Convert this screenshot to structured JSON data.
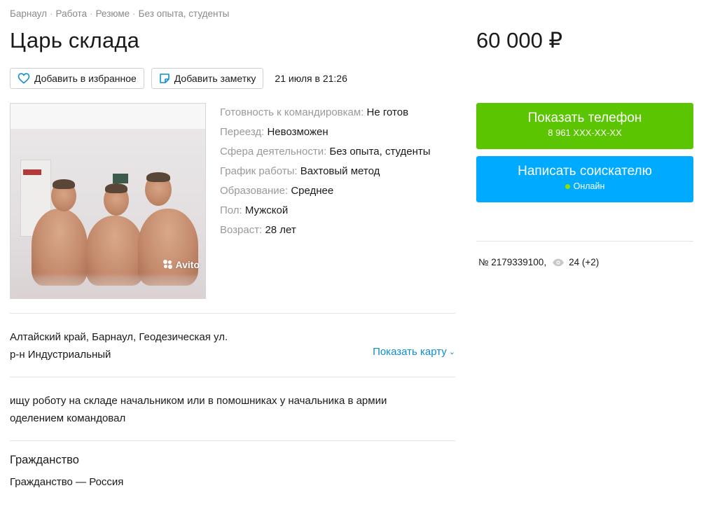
{
  "breadcrumb": {
    "items": [
      "Барнаул",
      "Работа",
      "Резюме",
      "Без опыта, студенты"
    ],
    "separator": "·"
  },
  "title": "Царь склада",
  "price": "60 000 ₽",
  "actions": {
    "favorite_label": "Добавить в избранное",
    "note_label": "Добавить заметку",
    "date": "21 июля в 21:26"
  },
  "photo": {
    "watermark": "Avito"
  },
  "params": [
    {
      "label": "Готовность к командировкам:",
      "value": "Не готов"
    },
    {
      "label": "Переезд:",
      "value": "Невозможен"
    },
    {
      "label": "Сфера деятельности:",
      "value": "Без опыта, студенты"
    },
    {
      "label": "График работы:",
      "value": "Вахтовый метод"
    },
    {
      "label": "Образование:",
      "value": "Среднее"
    },
    {
      "label": "Пол:",
      "value": "Мужской"
    },
    {
      "label": "Возраст:",
      "value": "28 лет"
    }
  ],
  "address": {
    "line1": "Алтайский край, Барнаул, Геодезическая ул.",
    "line2": "р-н Индустриальный",
    "show_map": "Показать карту"
  },
  "description": {
    "line1": "ищу роботу на складе начальником или в помошниках у начальника в армии",
    "line2": "оделением командовал"
  },
  "citizenship": {
    "title": "Гражданство",
    "value": "Гражданство — Россия"
  },
  "contact": {
    "phone_label": "Показать телефон",
    "phone_masked": "8 961 XXX-XX-XX",
    "write_label": "Написать соискателю",
    "online_status": "Онлайн",
    "colors": {
      "phone_bg": "#5ac500",
      "write_bg": "#00aaff",
      "online_dot": "#8fe000"
    }
  },
  "ad_meta": {
    "number": "№ 2179339100,",
    "views": "24 (+2)"
  }
}
